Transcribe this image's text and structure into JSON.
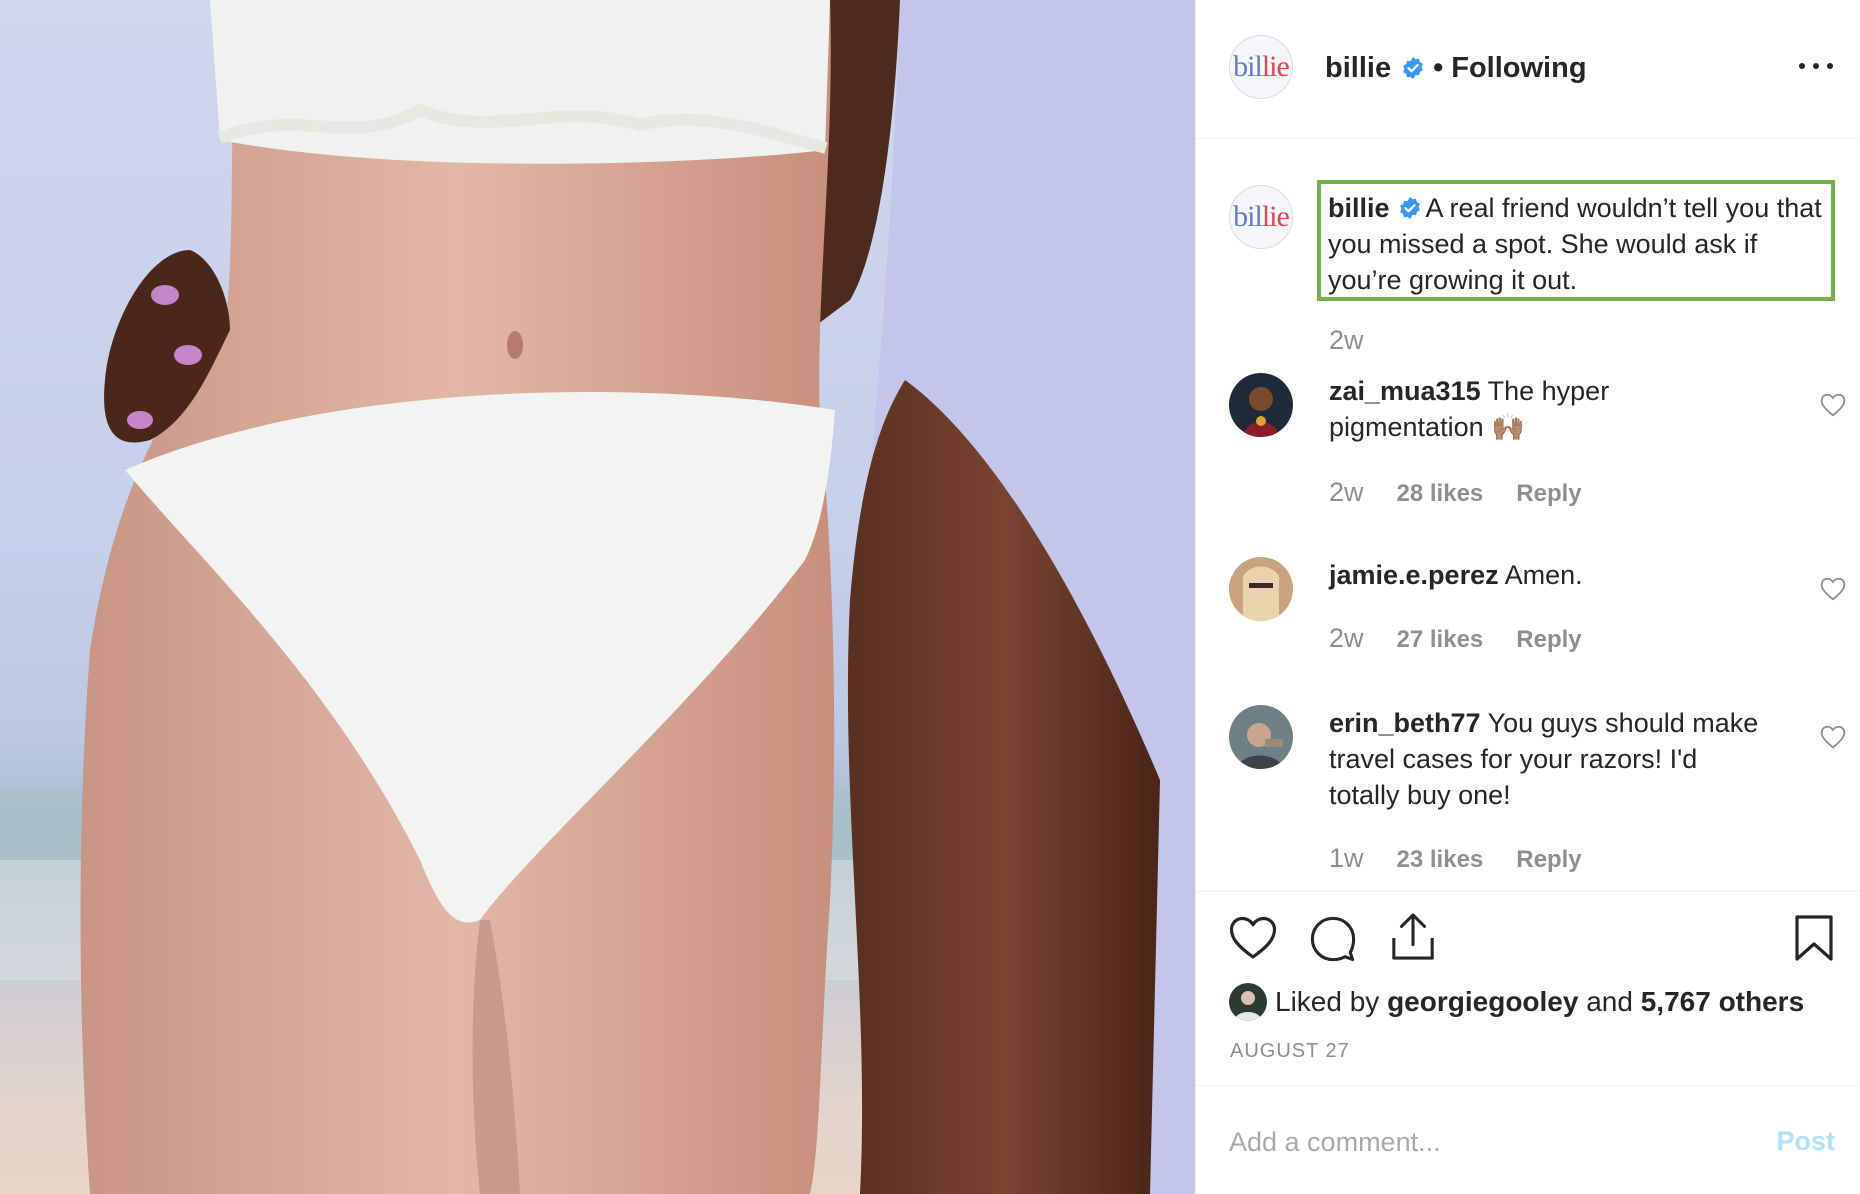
{
  "post": {
    "username": "billie",
    "following": "Following",
    "separator": "•",
    "caption": "A real friend wouldn’t tell you that you missed a spot. She would ask if you’re growing it out.",
    "caption_time": "2w",
    "liked_by_prefix": "Liked by",
    "liked_by_user": "georgiegooley",
    "liked_by_and": "and",
    "liked_by_others": "5,767 others",
    "date": "AUGUST 27"
  },
  "avatar_logo": {
    "part1": "bil",
    "part2": "lie"
  },
  "comments": [
    {
      "username": "zai_mua315",
      "text": "The hyper pigmentation 🙌🏽",
      "time": "2w",
      "likes": "28 likes",
      "reply": "Reply"
    },
    {
      "username": "jamie.e.perez",
      "text": "Amen.",
      "time": "2w",
      "likes": "27 likes",
      "reply": "Reply"
    },
    {
      "username": "erin_beth77",
      "text": "You guys should make travel cases for your razors! I'd totally buy one!",
      "time": "1w",
      "likes": "23 likes",
      "reply": "Reply"
    }
  ],
  "comment_bar": {
    "placeholder": "Add a comment...",
    "post_label": "Post"
  },
  "icons": {
    "verified": "verified-badge-icon",
    "more": "more-options-icon",
    "like": "heart-icon",
    "comment": "comment-bubble-icon",
    "share": "share-icon",
    "save": "bookmark-icon"
  },
  "colors": {
    "verified": "#3897f0",
    "highlight_border": "#74b14a",
    "post_button": "#b2dffc",
    "secondary_text": "#8e8e8e"
  }
}
